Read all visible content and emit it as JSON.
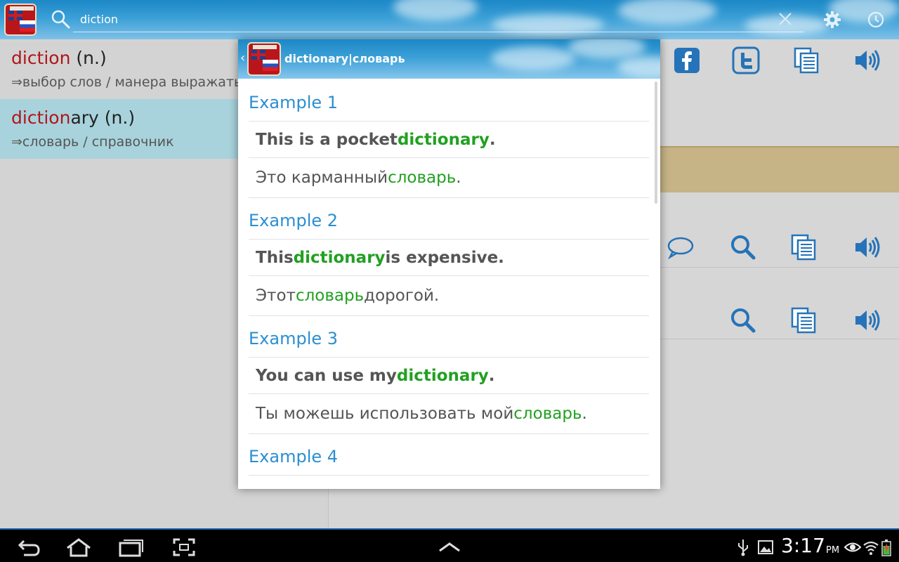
{
  "search": {
    "value": "diction"
  },
  "word_list": [
    {
      "highlight": "diction",
      "rest": "",
      "pos": " (n.)",
      "gloss": "⇒выбор слов / манера выражаться"
    },
    {
      "highlight": "diction",
      "rest": "ary",
      "pos": " (n.)",
      "gloss": "⇒словарь / справочник",
      "selected": true
    }
  ],
  "dialog": {
    "title": "dictionary|словарь",
    "back_glyph": "‹",
    "examples": [
      {
        "label": "Example 1",
        "en": {
          "before": "This is a pocket ",
          "key": "dictionary",
          "after": "."
        },
        "ru": {
          "before": "Это карманный ",
          "key": "словарь",
          "after": "."
        }
      },
      {
        "label": "Example 2",
        "en": {
          "before": "This ",
          "key": "dictionary",
          "after": " is expensive."
        },
        "ru": {
          "before": "Этот ",
          "key": "словарь",
          "after": " дорогой."
        }
      },
      {
        "label": "Example 3",
        "en": {
          "before": "You can use my ",
          "key": "dictionary",
          "after": "."
        },
        "ru": {
          "before": "Ты можешь использовать мой ",
          "key": "словарь",
          "after": "."
        }
      },
      {
        "label": "Example 4"
      }
    ]
  },
  "statusbar": {
    "time": "3:17",
    "ampm": "PM"
  },
  "colors": {
    "accent_blue": "#2b8fd1",
    "keyword_green": "#22a022",
    "headword_red": "#b0161b",
    "selected_row": "#a8d3dc"
  },
  "icons": [
    "app-icon",
    "search-icon",
    "clear-icon",
    "settings-icon",
    "history-icon",
    "facebook-icon",
    "twitter-icon",
    "copy-icon",
    "speaker-icon",
    "comment-icon",
    "back-icon",
    "home-icon",
    "recent-apps-icon",
    "screenshot-icon",
    "up-chevron-icon",
    "usb-icon",
    "gallery-icon",
    "eye-icon",
    "wifi-icon",
    "battery-icon"
  ]
}
